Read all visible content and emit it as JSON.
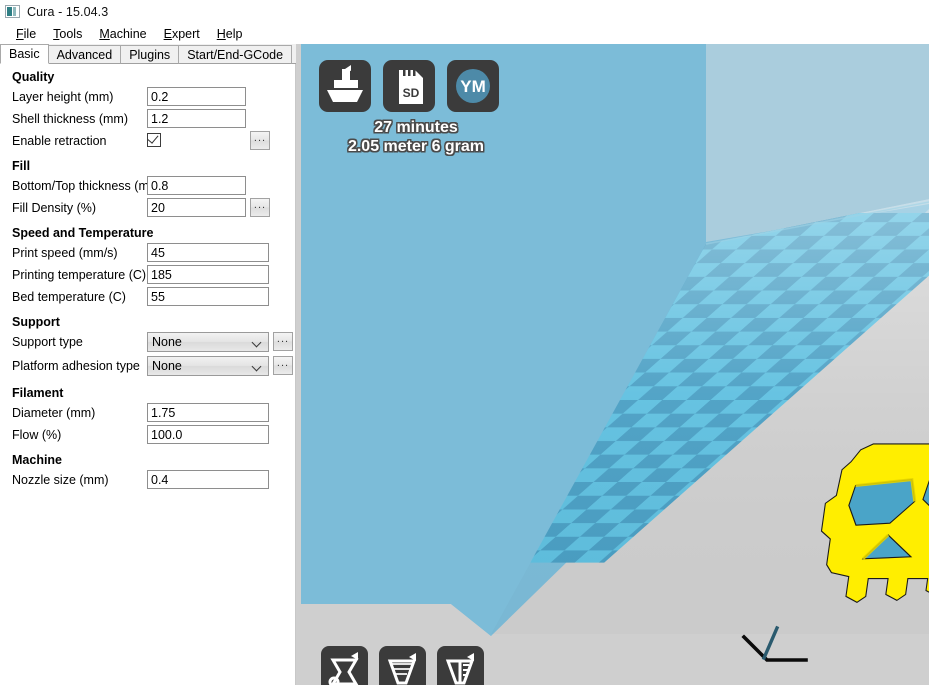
{
  "window": {
    "title": "Cura - 15.04.3",
    "icon": "cura-app-icon"
  },
  "menubar": {
    "items": [
      {
        "accel": "F",
        "rest": "ile"
      },
      {
        "accel": "T",
        "rest": "ools"
      },
      {
        "accel": "M",
        "rest": "achine"
      },
      {
        "accel": "E",
        "rest": "xpert"
      },
      {
        "accel": "H",
        "rest": "elp"
      }
    ]
  },
  "tabs": [
    {
      "label": "Basic",
      "active": true
    },
    {
      "label": "Advanced",
      "active": false
    },
    {
      "label": "Plugins",
      "active": false
    },
    {
      "label": "Start/End-GCode",
      "active": false
    }
  ],
  "settings": {
    "sections": [
      {
        "title": "Quality",
        "rows": [
          {
            "label": "Layer height (mm)",
            "type": "text",
            "value": "0.2",
            "width": "narrow",
            "dots": false
          },
          {
            "label": "Shell thickness (mm)",
            "type": "text",
            "value": "1.2",
            "width": "narrow",
            "dots": false
          },
          {
            "label": "Enable retraction",
            "type": "checkbox",
            "checked": true,
            "dots": true
          }
        ]
      },
      {
        "title": "Fill",
        "rows": [
          {
            "label": "Bottom/Top thickness (mm)",
            "type": "text",
            "value": "0.8",
            "width": "narrow",
            "dots": false
          },
          {
            "label": "Fill Density (%)",
            "type": "text",
            "value": "20",
            "width": "narrow",
            "dots": true
          }
        ]
      },
      {
        "title": "Speed and Temperature",
        "rows": [
          {
            "label": "Print speed (mm/s)",
            "type": "text",
            "value": "45",
            "width": "wide",
            "dots": false
          },
          {
            "label": "Printing temperature (C)",
            "type": "text",
            "value": "185",
            "width": "wide",
            "dots": false
          },
          {
            "label": "Bed temperature (C)",
            "type": "text",
            "value": "55",
            "width": "wide",
            "dots": false
          }
        ]
      },
      {
        "title": "Support",
        "rows": [
          {
            "label": "Support type",
            "type": "combo",
            "value": "None",
            "dots": true
          },
          {
            "label": "Platform adhesion type",
            "type": "combo",
            "value": "None",
            "dots": true
          }
        ]
      },
      {
        "title": "Filament",
        "rows": [
          {
            "label": "Diameter (mm)",
            "type": "text",
            "value": "1.75",
            "width": "wide",
            "dots": false
          },
          {
            "label": "Flow (%)",
            "type": "text",
            "value": "100.0",
            "width": "wide",
            "dots": false
          }
        ]
      },
      {
        "title": "Machine",
        "rows": [
          {
            "label": "Nozzle size (mm)",
            "type": "text",
            "value": "0.4",
            "width": "wide",
            "dots": false
          }
        ]
      }
    ],
    "dots_label": "..."
  },
  "viewport": {
    "top_toolbar": [
      {
        "icon": "save-toolpath-icon",
        "name": "save-gcode-button"
      },
      {
        "icon": "sd-card-icon",
        "name": "sd-card-button"
      },
      {
        "icon": "youmagine-icon",
        "name": "youmagine-button",
        "label": "YM"
      }
    ],
    "print_info": {
      "time": "27 minutes",
      "material": "2.05 meter 6 gram"
    },
    "bottom_toolbar": [
      {
        "icon": "rotate-model-icon",
        "name": "rotate-tool-button"
      },
      {
        "icon": "scale-model-icon",
        "name": "scale-tool-button"
      },
      {
        "icon": "mirror-model-icon",
        "name": "mirror-tool-button"
      }
    ],
    "model": {
      "name": "skull-model",
      "color": "#ffee00"
    },
    "colors": {
      "background": "#cfcfcf",
      "wall_back": "#aacddd",
      "wall_left": "#7cbcd8",
      "plate_light": "#5fc0e0",
      "plate_dark": "#4a9fc4",
      "origin_marker": "#0b0b0b"
    }
  }
}
